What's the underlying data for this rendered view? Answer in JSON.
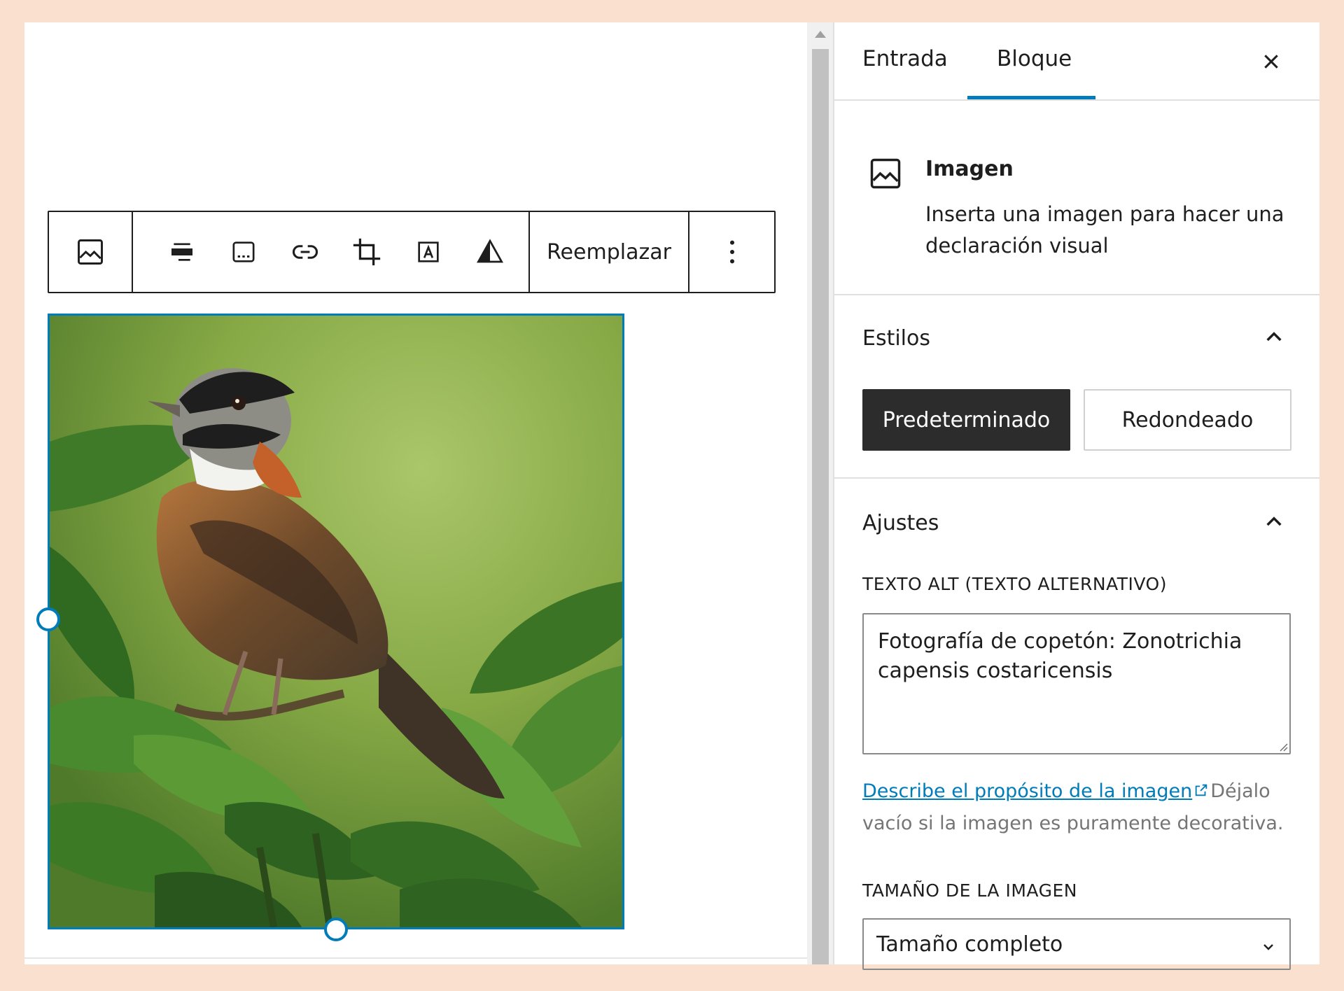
{
  "toolbar": {
    "block_type_icon": "image-icon",
    "tools": [
      {
        "icon": "align-icon"
      },
      {
        "icon": "caption-icon"
      },
      {
        "icon": "link-icon"
      },
      {
        "icon": "crop-icon"
      },
      {
        "icon": "text-over-image-icon"
      },
      {
        "icon": "duotone-filter-icon"
      }
    ],
    "replace_label": "Reemplazar",
    "more_icon": "more-vertical-icon"
  },
  "image": {
    "subject": "bird-photo"
  },
  "sidebar": {
    "tabs": [
      {
        "label": "Entrada",
        "active": false
      },
      {
        "label": "Bloque",
        "active": true
      }
    ],
    "block_card": {
      "icon": "image-icon",
      "title": "Imagen",
      "description": "Inserta una imagen para hacer una declaración visual"
    },
    "styles": {
      "title": "Estilos",
      "options": [
        {
          "label": "Predeterminado",
          "selected": true
        },
        {
          "label": "Redondeado",
          "selected": false
        }
      ]
    },
    "settings": {
      "title": "Ajustes",
      "alt_label": "TEXTO ALT (TEXTO ALTERNATIVO)",
      "alt_value": "Fotografía de copetón: Zonotrichia capensis costaricensis",
      "help_link": "Describe el propósito de la imagen",
      "help_text": "Déjalo vacío si la imagen es puramente decorativa.",
      "size_label": "TAMAÑO DE LA IMAGEN",
      "size_value": "Tamaño completo"
    }
  },
  "colors": {
    "accent": "#007cba",
    "background": "#fae1cf",
    "dark_button": "#2c2c2c"
  }
}
